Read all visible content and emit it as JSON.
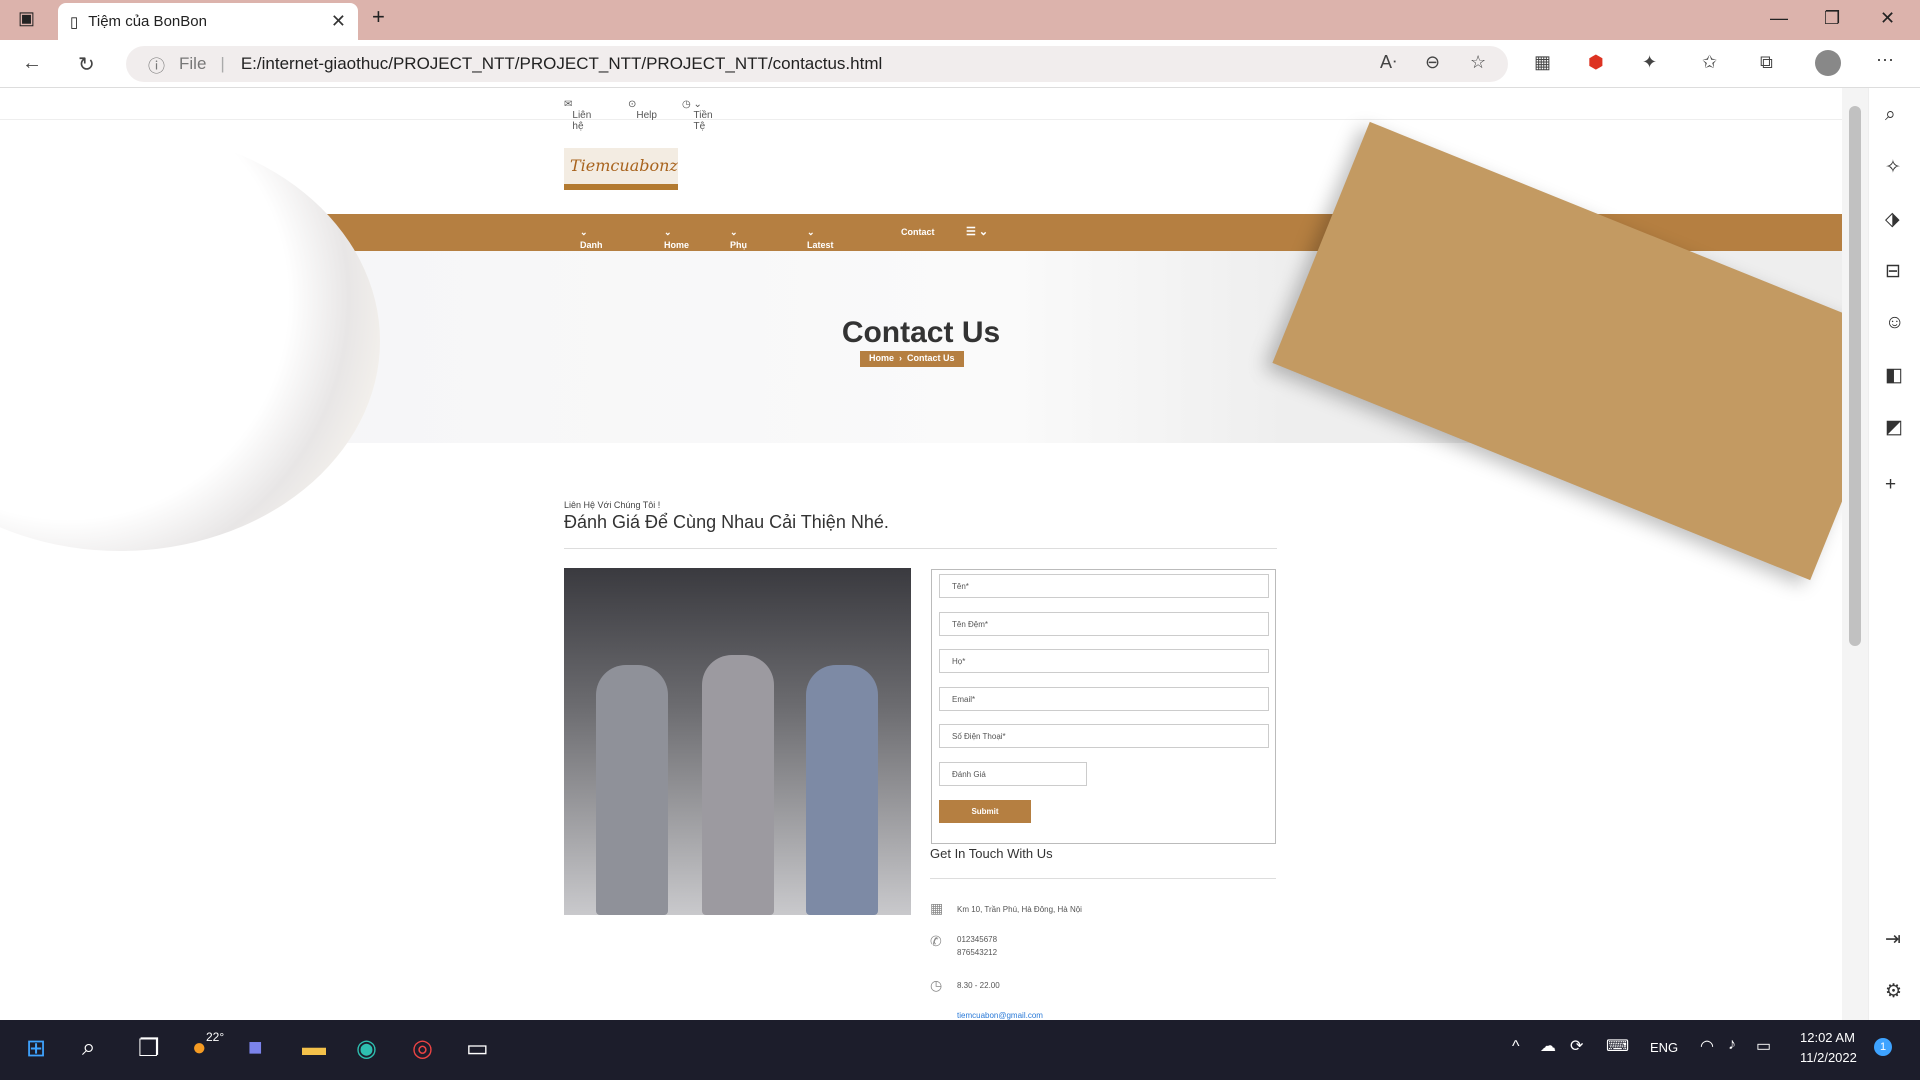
{
  "browser": {
    "tab_title": "Tiệm của BonBon",
    "url_prefix": "File",
    "url": "E:/internet-giaothuc/PROJECT_NTT/PROJECT_NTT/PROJECT_NTT/contactus.html"
  },
  "topbar": {
    "contact": "Liên hệ",
    "help": "Help",
    "currency": "Tiền Tệ"
  },
  "logo_text": "Tiemcuabonz",
  "nav": {
    "items": [
      "Danh mục",
      "Home",
      "Phụ kiện",
      "Latest News",
      "Contact"
    ]
  },
  "hero": {
    "title": "Contact Us",
    "crumb_home": "Home",
    "crumb_current": "Contact Us"
  },
  "section": {
    "subtitle": "Liên Hệ Với Chúng Tôi !",
    "heading": "Đánh Giá Để Cùng Nhau Cải Thiện Nhé."
  },
  "form": {
    "first_name": "Tên*",
    "middle_name": "Tên Đệm*",
    "last_name": "Họ*",
    "email": "Email*",
    "phone": "Số Điện Thoại*",
    "review": "Đánh Giá",
    "submit": "Submit"
  },
  "contact": {
    "title": "Get In Touch With Us",
    "address": "Km 10, Trần Phú, Hà Đông, Hà Nội",
    "phone1": "012345678",
    "phone2": "876543212",
    "hours": "8.30 - 22.00",
    "email": "tiemcuabon@gmail.com"
  },
  "taskbar": {
    "weather": "22°",
    "lang": "ENG",
    "time": "12:02 AM",
    "date": "11/2/2022",
    "notifications": "1"
  },
  "colors": {
    "accent": "#b57f41",
    "titlebar": "#dcb3ac",
    "taskbar": "#1c1d2b"
  }
}
